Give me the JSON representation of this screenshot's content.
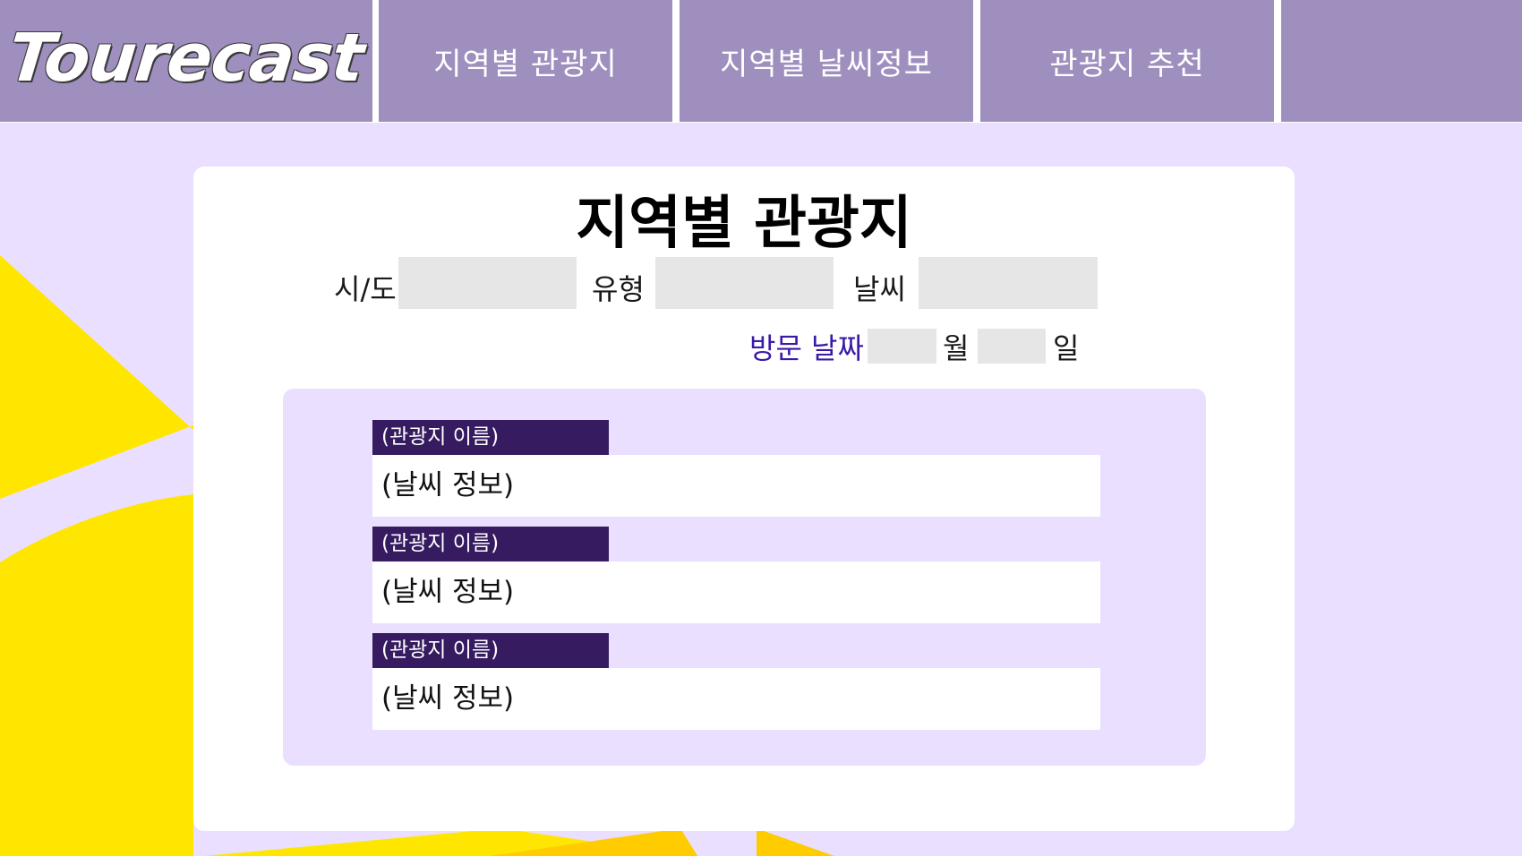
{
  "nav": {
    "logo": "Tourecast",
    "items": [
      {
        "label": "지역별 관광지"
      },
      {
        "label": "지역별 날씨정보"
      },
      {
        "label": "관광지 추천"
      },
      {
        "label": ""
      }
    ]
  },
  "main": {
    "title": "지역별 관광지",
    "filters": {
      "sido_label": "시/도",
      "sido_value": "",
      "type_label": "유형",
      "type_value": "",
      "weather_label": "날씨",
      "weather_value": ""
    },
    "visit_date": {
      "label": "방문 날짜",
      "month_value": "",
      "month_unit": "월",
      "day_value": "",
      "day_unit": "일"
    },
    "results": [
      {
        "name": "(관광지 이름)",
        "weather": "(날씨 정보)"
      },
      {
        "name": "(관광지 이름)",
        "weather": "(날씨 정보)"
      },
      {
        "name": "(관광지 이름)",
        "weather": "(날씨 정보)"
      }
    ]
  },
  "colors": {
    "nav_bg": "#9f8fbe",
    "page_bg": "#eadfff",
    "accent_yellow": "#ffe600",
    "item_header": "#361b60",
    "visit_label": "#3b1aa8"
  }
}
